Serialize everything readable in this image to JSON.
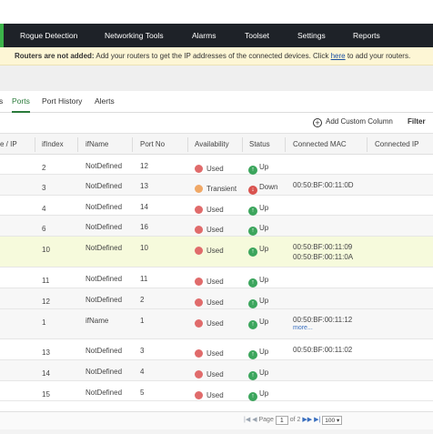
{
  "nav": {
    "items": [
      "Rogue Detection",
      "Networking Tools",
      "Alarms",
      "Toolset",
      "Settings",
      "Reports"
    ],
    "accent": "#3cb44a",
    "bg": "#1e2228"
  },
  "banner": {
    "bold": "Routers are not added:",
    "text1": " Add your routers to get the IP addresses of the connected devices. Click ",
    "link": "here",
    "text2": " to add your routers."
  },
  "tabs": {
    "partial": "s",
    "ports": "Ports",
    "port_history": "Port History",
    "alerts": "Alerts"
  },
  "toolbar": {
    "add_column": "Add Custom Column",
    "filter": "Filter"
  },
  "table": {
    "headers": [
      "e / IP",
      "ifIndex",
      "ifName",
      "Port No",
      "Availability",
      "Status",
      "Connected MAC",
      "Connected IP"
    ],
    "rows": [
      {
        "ifIndex": "2",
        "ifName": "NotDefined",
        "port": "12",
        "avail": "Used",
        "avail_color": "#e06b6b",
        "status": "Up",
        "status_color": "#3ba55c",
        "arrow": "↑",
        "mac": [],
        "more": ""
      },
      {
        "ifIndex": "3",
        "ifName": "NotDefined",
        "port": "13",
        "avail": "Transient",
        "avail_color": "#f0a866",
        "status": "Down",
        "status_color": "#d9534f",
        "arrow": "↓",
        "mac": [
          "00:50:BF:00:11:0D"
        ],
        "more": ""
      },
      {
        "ifIndex": "4",
        "ifName": "NotDefined",
        "port": "14",
        "avail": "Used",
        "avail_color": "#e06b6b",
        "status": "Up",
        "status_color": "#3ba55c",
        "arrow": "↑",
        "mac": [],
        "more": ""
      },
      {
        "ifIndex": "6",
        "ifName": "NotDefined",
        "port": "16",
        "avail": "Used",
        "avail_color": "#e06b6b",
        "status": "Up",
        "status_color": "#3ba55c",
        "arrow": "↑",
        "mac": [],
        "more": ""
      },
      {
        "ifIndex": "10",
        "ifName": "NotDefined",
        "port": "10",
        "avail": "Used",
        "avail_color": "#e06b6b",
        "status": "Up",
        "status_color": "#3ba55c",
        "arrow": "↑",
        "mac": [
          "00:50:BF:00:11:09",
          "00:50:BF:00:11:0A"
        ],
        "more": ""
      },
      {
        "ifIndex": "11",
        "ifName": "NotDefined",
        "port": "11",
        "avail": "Used",
        "avail_color": "#e06b6b",
        "status": "Up",
        "status_color": "#3ba55c",
        "arrow": "↑",
        "mac": [],
        "more": ""
      },
      {
        "ifIndex": "12",
        "ifName": "NotDefined",
        "port": "2",
        "avail": "Used",
        "avail_color": "#e06b6b",
        "status": "Up",
        "status_color": "#3ba55c",
        "arrow": "↑",
        "mac": [],
        "more": ""
      },
      {
        "ifIndex": "1",
        "ifName": "ifName",
        "port": "1",
        "avail": "Used",
        "avail_color": "#e06b6b",
        "status": "Up",
        "status_color": "#3ba55c",
        "arrow": "↑",
        "mac": [
          "00:50:BF:00:11:12"
        ],
        "more": "more..."
      },
      {
        "ifIndex": "13",
        "ifName": "NotDefined",
        "port": "3",
        "avail": "Used",
        "avail_color": "#e06b6b",
        "status": "Up",
        "status_color": "#3ba55c",
        "arrow": "↑",
        "mac": [
          "00:50:BF:00:11:02"
        ],
        "more": ""
      },
      {
        "ifIndex": "14",
        "ifName": "NotDefined",
        "port": "4",
        "avail": "Used",
        "avail_color": "#e06b6b",
        "status": "Up",
        "status_color": "#3ba55c",
        "arrow": "↑",
        "mac": [],
        "more": ""
      },
      {
        "ifIndex": "15",
        "ifName": "NotDefined",
        "port": "5",
        "avail": "Used",
        "avail_color": "#e06b6b",
        "status": "Up",
        "status_color": "#3ba55c",
        "arrow": "↑",
        "mac": [],
        "more": ""
      }
    ]
  },
  "pager": {
    "page_label": "Page",
    "page": "1",
    "of": "of 2",
    "page_size": "100"
  }
}
